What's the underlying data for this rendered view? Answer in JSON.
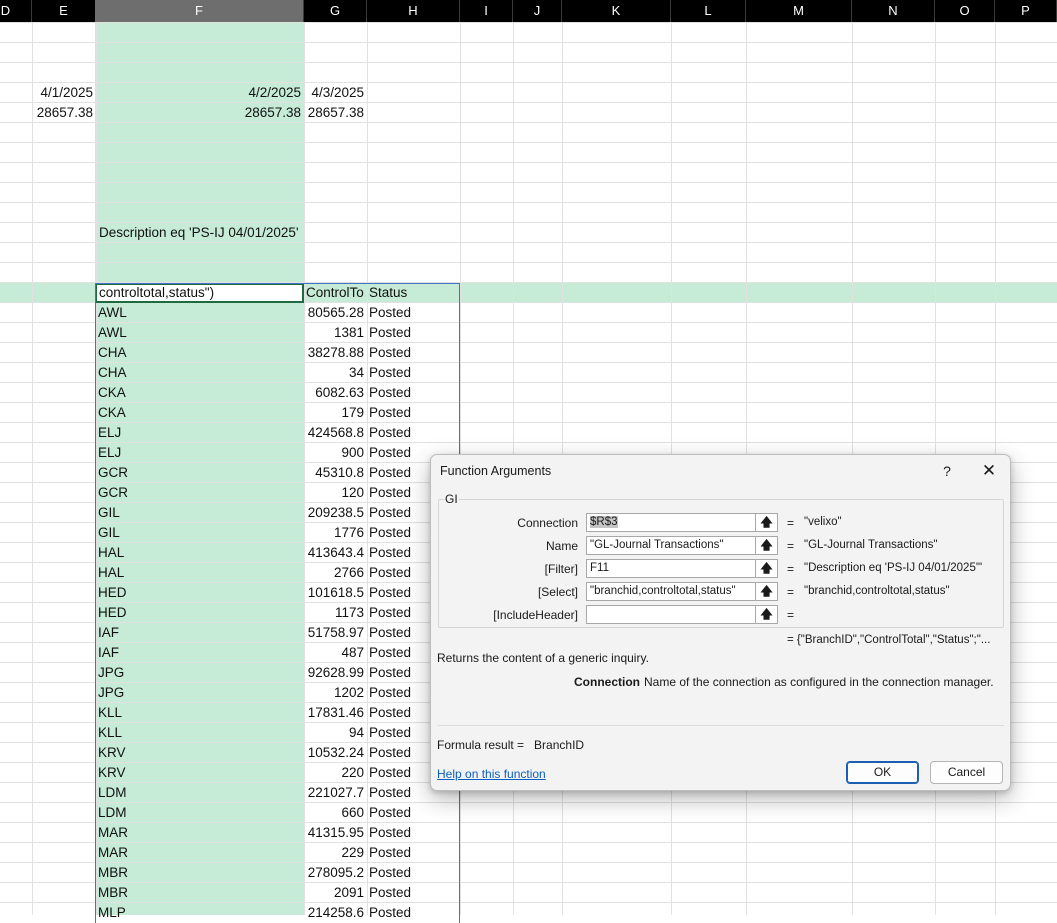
{
  "columns": [
    {
      "key": "D",
      "label": "D"
    },
    {
      "key": "E",
      "label": "E"
    },
    {
      "key": "F",
      "label": "F"
    },
    {
      "key": "G",
      "label": "G"
    },
    {
      "key": "H",
      "label": "H"
    },
    {
      "key": "I",
      "label": "I"
    },
    {
      "key": "J",
      "label": "J"
    },
    {
      "key": "K",
      "label": "K"
    },
    {
      "key": "L",
      "label": "L"
    },
    {
      "key": "M",
      "label": "M"
    },
    {
      "key": "N",
      "label": "N"
    },
    {
      "key": "O",
      "label": "O"
    },
    {
      "key": "P",
      "label": "P"
    }
  ],
  "selected_column": "F",
  "accent_colors": {
    "selection": "#c6ebd6",
    "active_border": "#1e6b42",
    "spill_border": "#4472c4",
    "link": "#0b5fc1"
  },
  "top_cells": {
    "e_date": "4/1/2025",
    "f_date": "4/2/2025",
    "g_date": "4/3/2025",
    "e_amount": "28657.38",
    "f_amount": "28657.38",
    "g_amount": "28657.38",
    "filter_text": "Description eq 'PS-IJ 04/01/2025'"
  },
  "active_cell": {
    "value": "controltotal,status\")"
  },
  "spill_header": {
    "g": "ControlTo",
    "h": "Status"
  },
  "rows": [
    {
      "branch": "AWL",
      "total": "80565.28",
      "status": "Posted"
    },
    {
      "branch": "AWL",
      "total": "1381",
      "status": "Posted"
    },
    {
      "branch": "CHA",
      "total": "38278.88",
      "status": "Posted"
    },
    {
      "branch": "CHA",
      "total": "34",
      "status": "Posted"
    },
    {
      "branch": "CKA",
      "total": "6082.63",
      "status": "Posted"
    },
    {
      "branch": "CKA",
      "total": "179",
      "status": "Posted"
    },
    {
      "branch": "ELJ",
      "total": "424568.8",
      "status": "Posted"
    },
    {
      "branch": "ELJ",
      "total": "900",
      "status": "Posted"
    },
    {
      "branch": "GCR",
      "total": "45310.8",
      "status": "Posted"
    },
    {
      "branch": "GCR",
      "total": "120",
      "status": "Posted"
    },
    {
      "branch": "GIL",
      "total": "209238.5",
      "status": "Posted"
    },
    {
      "branch": "GIL",
      "total": "1776",
      "status": "Posted"
    },
    {
      "branch": "HAL",
      "total": "413643.4",
      "status": "Posted"
    },
    {
      "branch": "HAL",
      "total": "2766",
      "status": "Posted"
    },
    {
      "branch": "HED",
      "total": "101618.5",
      "status": "Posted"
    },
    {
      "branch": "HED",
      "total": "1173",
      "status": "Posted"
    },
    {
      "branch": "IAF",
      "total": "51758.97",
      "status": "Posted"
    },
    {
      "branch": "IAF",
      "total": "487",
      "status": "Posted"
    },
    {
      "branch": "JPG",
      "total": "92628.99",
      "status": "Posted"
    },
    {
      "branch": "JPG",
      "total": "1202",
      "status": "Posted"
    },
    {
      "branch": "KLL",
      "total": "17831.46",
      "status": "Posted"
    },
    {
      "branch": "KLL",
      "total": "94",
      "status": "Posted"
    },
    {
      "branch": "KRV",
      "total": "10532.24",
      "status": "Posted"
    },
    {
      "branch": "KRV",
      "total": "220",
      "status": "Posted"
    },
    {
      "branch": "LDM",
      "total": "221027.7",
      "status": "Posted"
    },
    {
      "branch": "LDM",
      "total": "660",
      "status": "Posted"
    },
    {
      "branch": "MAR",
      "total": "41315.95",
      "status": "Posted"
    },
    {
      "branch": "MAR",
      "total": "229",
      "status": "Posted"
    },
    {
      "branch": "MBR",
      "total": "278095.2",
      "status": "Posted"
    },
    {
      "branch": "MBR",
      "total": "2091",
      "status": "Posted"
    },
    {
      "branch": "MLP",
      "total": "214258.6",
      "status": "Posted"
    }
  ],
  "dialog": {
    "title": "Function Arguments",
    "help_glyph": "?",
    "close_glyph": "✕",
    "function_name": "GI",
    "args": [
      {
        "label": "Connection",
        "value": "$R$3",
        "result": "\"velixo\""
      },
      {
        "label": "Name",
        "value": "\"GL-Journal Transactions\"",
        "result": "\"GL-Journal Transactions\""
      },
      {
        "label": "[Filter]",
        "value": "F11",
        "result": "\"Description eq 'PS-IJ 04/01/2025'\""
      },
      {
        "label": "[Select]",
        "value": "\"branchid,controltotal,status\"",
        "result": "\"branchid,controltotal,status\""
      },
      {
        "label": "[IncludeHeader]",
        "value": "",
        "result": ""
      }
    ],
    "ref_button_glyph": "🡅",
    "equals": "=",
    "overall_result": "= {\"BranchID\",\"ControlTotal\",\"Status\";\"...",
    "description": "Returns the content of a generic inquiry.",
    "param_name": "Connection",
    "param_description": "Name of the connection as configured in the connection manager.",
    "formula_result_label": "Formula result =",
    "formula_result_value": "BranchID",
    "help_link": "Help on this function",
    "ok_label": "OK",
    "cancel_label": "Cancel"
  }
}
